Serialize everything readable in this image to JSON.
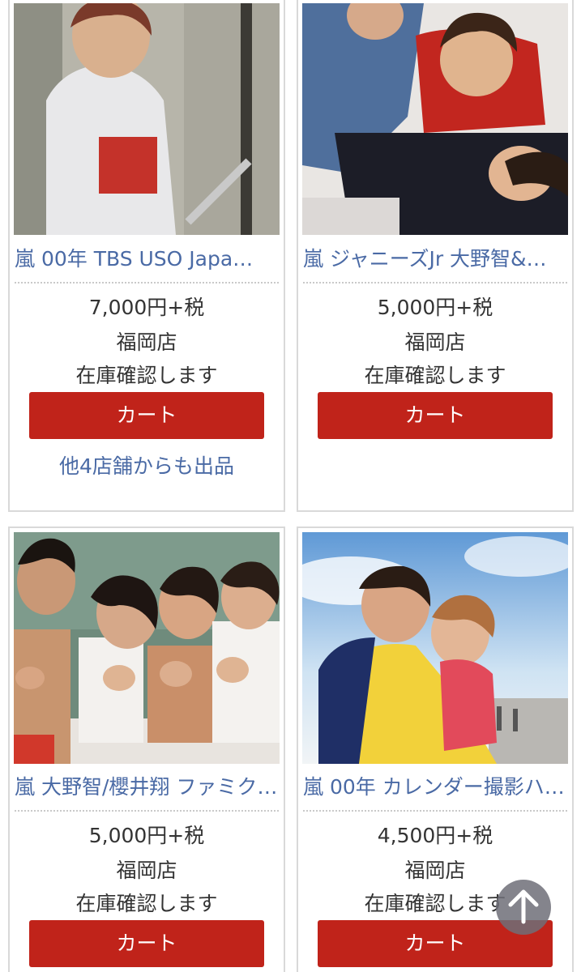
{
  "products": [
    {
      "title": "嵐 00年 TBS USO Japa…",
      "price": "7,000円+税",
      "store": "福岡店",
      "stock": "在庫確認します",
      "cart_label": "カート",
      "other_stores": "他4店舗からも出品"
    },
    {
      "title": "嵐 ジャニーズJr 大野智&…",
      "price": "5,000円+税",
      "store": "福岡店",
      "stock": "在庫確認します",
      "cart_label": "カート"
    },
    {
      "title": "嵐 大野智/櫻井翔 ファミク…",
      "price": "5,000円+税",
      "store": "福岡店",
      "stock": "在庫確認します",
      "cart_label": "カート"
    },
    {
      "title": "嵐 00年 カレンダー撮影ハ…",
      "price": "4,500円+税",
      "store": "福岡店",
      "stock": "在庫確認します",
      "cart_label": "カート"
    }
  ],
  "colors": {
    "link_blue": "#4a6aa5",
    "cart_red": "#c0231a",
    "scroll_button_gray": "#6e6e78"
  },
  "icons": {
    "scroll_top": "arrow-up-icon"
  }
}
